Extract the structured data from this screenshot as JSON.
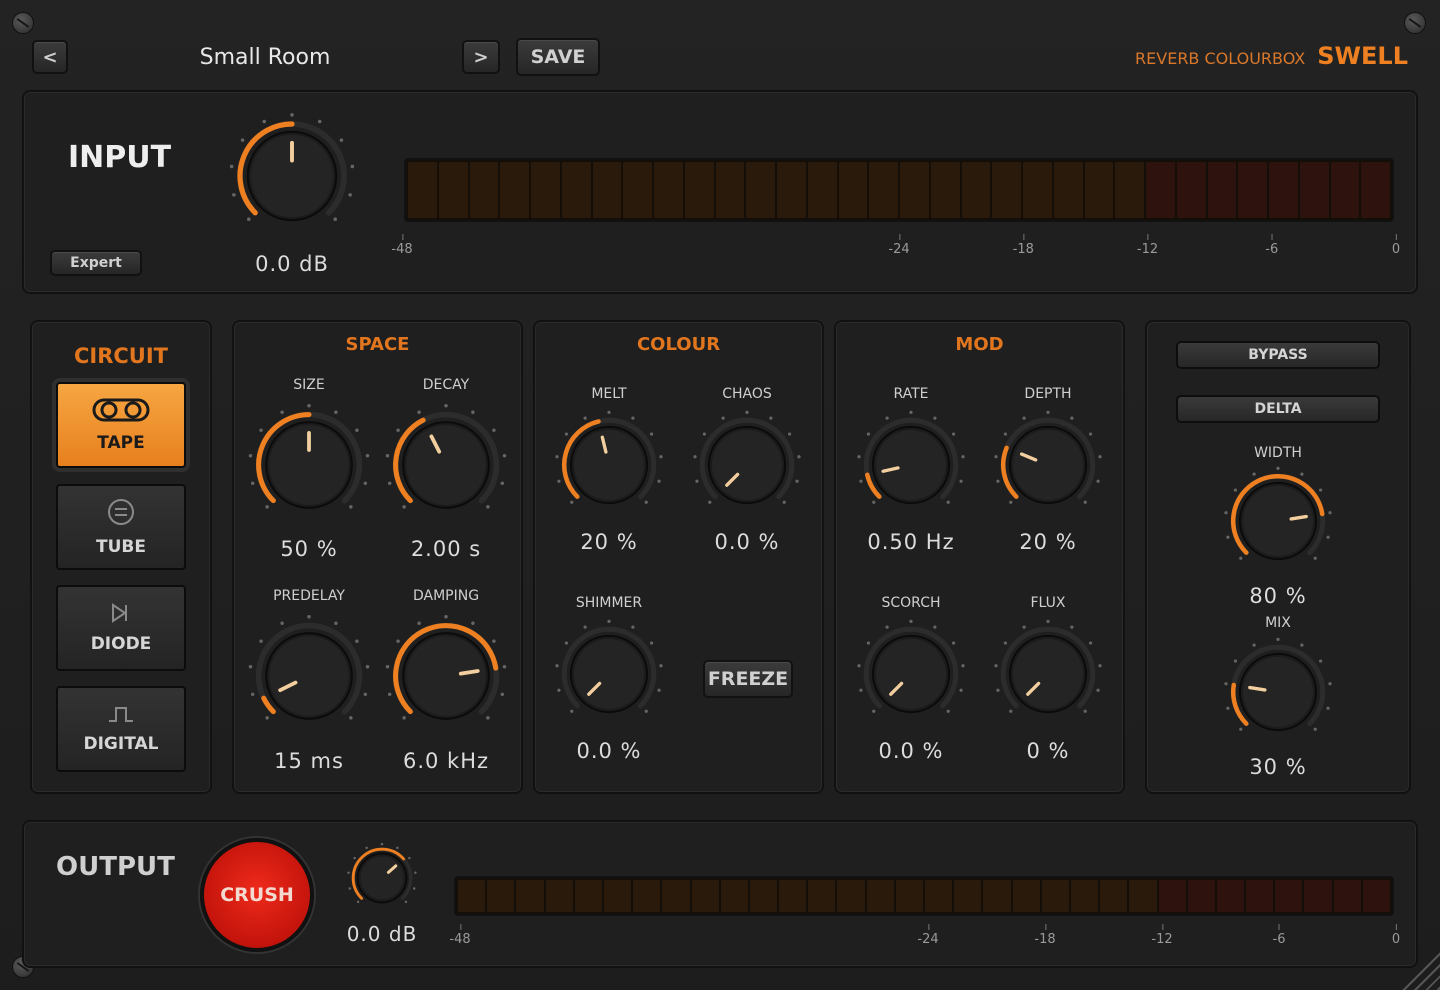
{
  "header": {
    "prev_label": "<",
    "next_label": ">",
    "preset_name": "Small Room",
    "save_label": "SAVE",
    "brand_sub": "REVERB COLOURBOX",
    "brand_main": "SWELL"
  },
  "input": {
    "title": "INPUT",
    "expert_label": "Expert",
    "gain_value": "0.0 dB",
    "gain_fraction": 0.5,
    "meter_scale": [
      "-48",
      "-24",
      "-18",
      "-12",
      "-6",
      "0"
    ]
  },
  "circuit": {
    "title": "CIRCUIT",
    "buttons": [
      {
        "label": "TAPE",
        "icon": "tape-icon",
        "active": true
      },
      {
        "label": "TUBE",
        "icon": "tube-icon",
        "active": false
      },
      {
        "label": "DIODE",
        "icon": "diode-icon",
        "active": false
      },
      {
        "label": "DIGITAL",
        "icon": "digital-icon",
        "active": false
      }
    ]
  },
  "space": {
    "title": "SPACE",
    "size": {
      "label": "SIZE",
      "value": "50 %",
      "fraction": 0.5
    },
    "decay": {
      "label": "DECAY",
      "value": "2.00 s",
      "fraction": 0.4
    },
    "predelay": {
      "label": "PREDELAY",
      "value": "15 ms",
      "fraction": 0.07
    },
    "damping": {
      "label": "DAMPING",
      "value": "6.0 kHz",
      "fraction": 0.8
    }
  },
  "colour": {
    "title": "COLOUR",
    "melt": {
      "label": "MELT",
      "value": "20 %",
      "fraction": 0.45
    },
    "chaos": {
      "label": "CHAOS",
      "value": "0.0 %",
      "fraction": 0.0
    },
    "shimmer": {
      "label": "SHIMMER",
      "value": "0.0 %",
      "fraction": 0.0
    },
    "freeze_label": "FREEZE"
  },
  "mod": {
    "title": "MOD",
    "rate": {
      "label": "RATE",
      "value": "0.50 Hz",
      "fraction": 0.12
    },
    "depth": {
      "label": "DEPTH",
      "value": "20 %",
      "fraction": 0.25
    },
    "scorch": {
      "label": "SCORCH",
      "value": "0.0 %",
      "fraction": 0.0
    },
    "flux": {
      "label": "FLUX",
      "value": "0 %",
      "fraction": 0.0
    }
  },
  "master": {
    "bypass_label": "BYPASS",
    "delta_label": "DELTA",
    "width": {
      "label": "WIDTH",
      "value": "80 %",
      "fraction": 0.8
    },
    "mix": {
      "label": "MIX",
      "value": "30 %",
      "fraction": 0.2
    }
  },
  "output": {
    "title": "OUTPUT",
    "crush_label": "CRUSH",
    "gain_value": "0.0 dB",
    "gain_fraction": 0.68,
    "meter_scale": [
      "-48",
      "-24",
      "-18",
      "-12",
      "-6",
      "0"
    ]
  },
  "colors": {
    "accent": "#ef8021",
    "crush_red": "#d8160c"
  }
}
